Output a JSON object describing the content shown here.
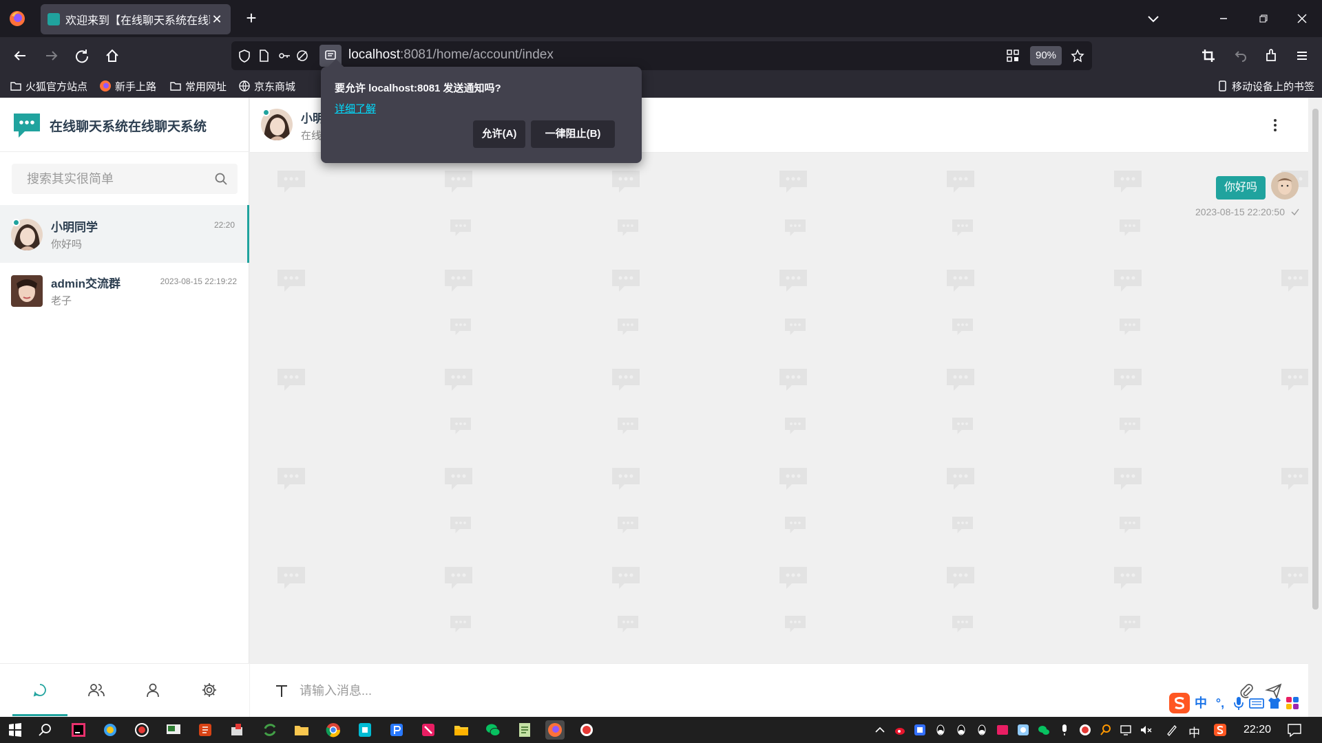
{
  "browser": {
    "tab_title": "欢迎来到【在线聊天系统在线聊",
    "url_host": "localhost",
    "url_rest": ":8081/home/account/index",
    "zoom": "90%",
    "bookmarks": [
      "火狐官方站点",
      "新手上路",
      "常用网址",
      "京东商城"
    ],
    "mobile_bookmarks": "移动设备上的书签"
  },
  "notification_prompt": {
    "title": "要允许 localhost:8081 发送通知吗?",
    "learn_more": "详细了解",
    "allow_label": "允许(A)",
    "block_label": "一律阻止(B)"
  },
  "sidebar": {
    "brand": "在线聊天系统在线聊天系统",
    "search_placeholder": "搜索其实很简单",
    "conversations": [
      {
        "name": "小明同学",
        "time": "22:20",
        "last_message": "你好吗",
        "online": true
      },
      {
        "name": "admin交流群",
        "time": "2023-08-15 22:19:22",
        "last_message": "老子",
        "online": false
      }
    ]
  },
  "chat": {
    "header_name": "小明",
    "header_status": "在线",
    "messages": [
      {
        "text": "你好吗",
        "time": "2023-08-15 22:20:50",
        "from_me": true
      }
    ],
    "input_placeholder": "请输入消息..."
  },
  "ime": {
    "items": [
      "中",
      "°,"
    ]
  },
  "taskbar": {
    "lang": "中",
    "clock": "22:20"
  },
  "colors": {
    "accent": "#20a39e",
    "chrome_dark": "#1c1b22",
    "chrome_mid": "#2b2a33",
    "popup": "#42414d"
  }
}
